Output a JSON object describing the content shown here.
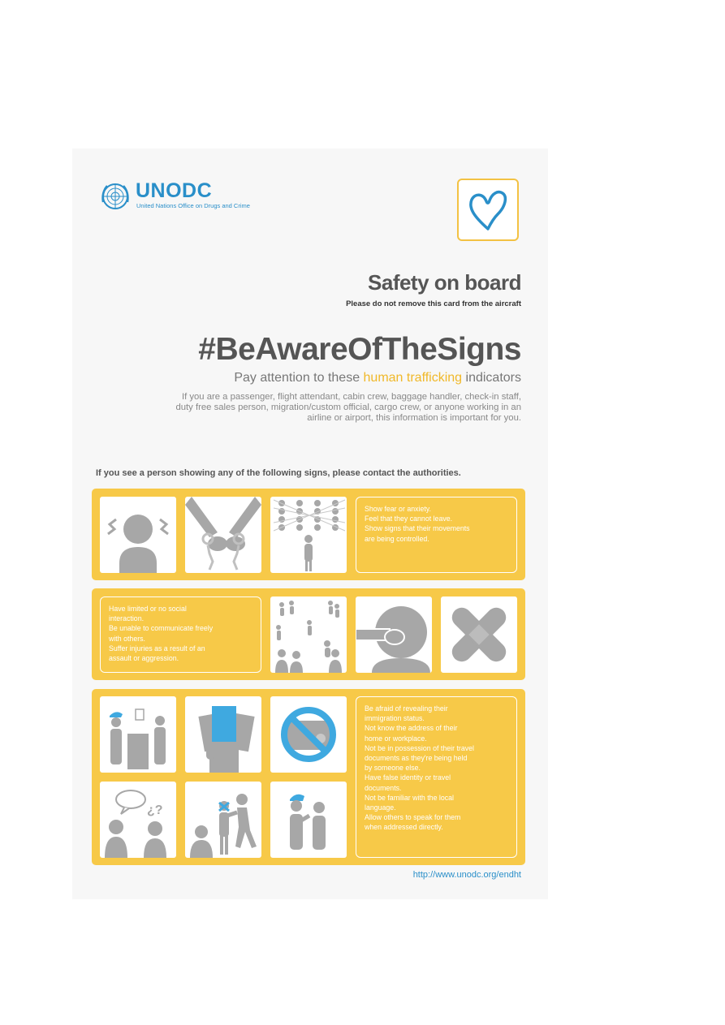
{
  "header": {
    "org_name": "UNODC",
    "org_full_name": "United Nations Office on Drugs and Crime",
    "title": "Safety on board",
    "subtitle": "Please do not remove this card from the aircraft",
    "hashtag": "#BeAwareOfTheSigns",
    "pay_attention": {
      "before": "Pay attention to these ",
      "highlight": "human trafficking",
      "after": " indicators"
    },
    "intro": "If you are a passenger, flight attendant, cabin crew, baggage handler, check-in staff, duty free sales person, migration/custom official, cargo crew, or anyone working in an airline or airport, this information is important for you."
  },
  "instruction": "If you see a person showing any of the following signs, please contact the authorities.",
  "panels": [
    {
      "text": "Show fear or anxiety.\nFeel that they cannot leave.\nShow signs that their movements\nare being controlled.",
      "icons": [
        "anxious-person-icon",
        "handcuffed-hands-icon",
        "controlled-person-icon"
      ]
    },
    {
      "text": "Have limited or no social\ninteraction.\nBe unable to communicate freely\nwith others.\nSuffer injuries as a result of an\nassault or aggression.",
      "icons": [
        "isolated-crowd-icon",
        "covered-mouth-icon",
        "bandage-icon"
      ]
    },
    {
      "text": "Be afraid of revealing their\nimmigration status.\nNot know the address of their\nhome or workplace.\nNot be in possession of their travel\ndocuments as they're being held\nby someone else.\nHave false identity or travel\ndocuments.\nNot be familiar with the local\nlanguage.\nAllow others to speak for them\nwhen addressed directly.",
      "icons": [
        "officer-document-icon",
        "held-passport-icon",
        "no-document-icon",
        "confused-speech-icon",
        "silenced-person-icon",
        "officer-talking-icon"
      ]
    }
  ],
  "footer": {
    "url": "http://www.unodc.org/endht"
  },
  "colors": {
    "yellow": "#f7c948",
    "blue": "#2a8fc9",
    "light_blue": "#3fa9e0",
    "grey": "#a7a7a7"
  }
}
